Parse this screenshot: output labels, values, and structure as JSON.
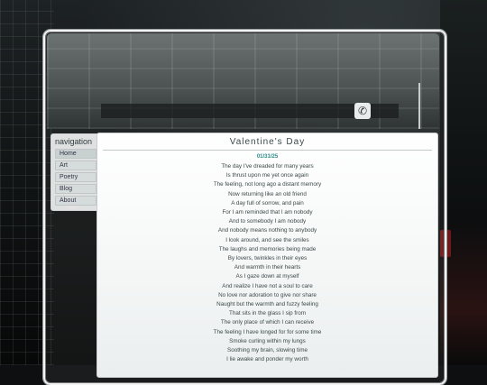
{
  "navigation": {
    "title": "navigation",
    "items": [
      {
        "label": "Home"
      },
      {
        "label": "Art"
      },
      {
        "label": "Poetry"
      },
      {
        "label": "Blog"
      },
      {
        "label": "About"
      }
    ]
  },
  "post": {
    "title": "Valentine's Day",
    "date": "01/31/25",
    "lines": [
      "The day I've dreaded for many years",
      "Is thrust upon me yet once again",
      "The feeling, not long ago a distant memory",
      "Now returning like an old friend",
      "A day full of sorrow, and pain",
      "For I am reminded that I am nobody",
      "And to somebody I am nobody",
      "And nobody means nothing to anybody",
      "I look around, and see the smiles",
      "The laughs and memories being made",
      "By lovers, twinkles in their eyes",
      "And warmth in their hearts",
      "As I gaze down at myself",
      "And realize I have not a soul to care",
      "No love nor adoration to give nor share",
      "Naught but the warmth and fuzzy feeling",
      "That sits in the glass I sip from",
      "The only place of which I can receive",
      "The feeling I have longed for for some time",
      "Smoke curling within my lungs",
      "Soothing my brain, slowing time",
      "I lie awake and ponder my worth"
    ]
  },
  "icons": {
    "phone": "phone-icon"
  }
}
